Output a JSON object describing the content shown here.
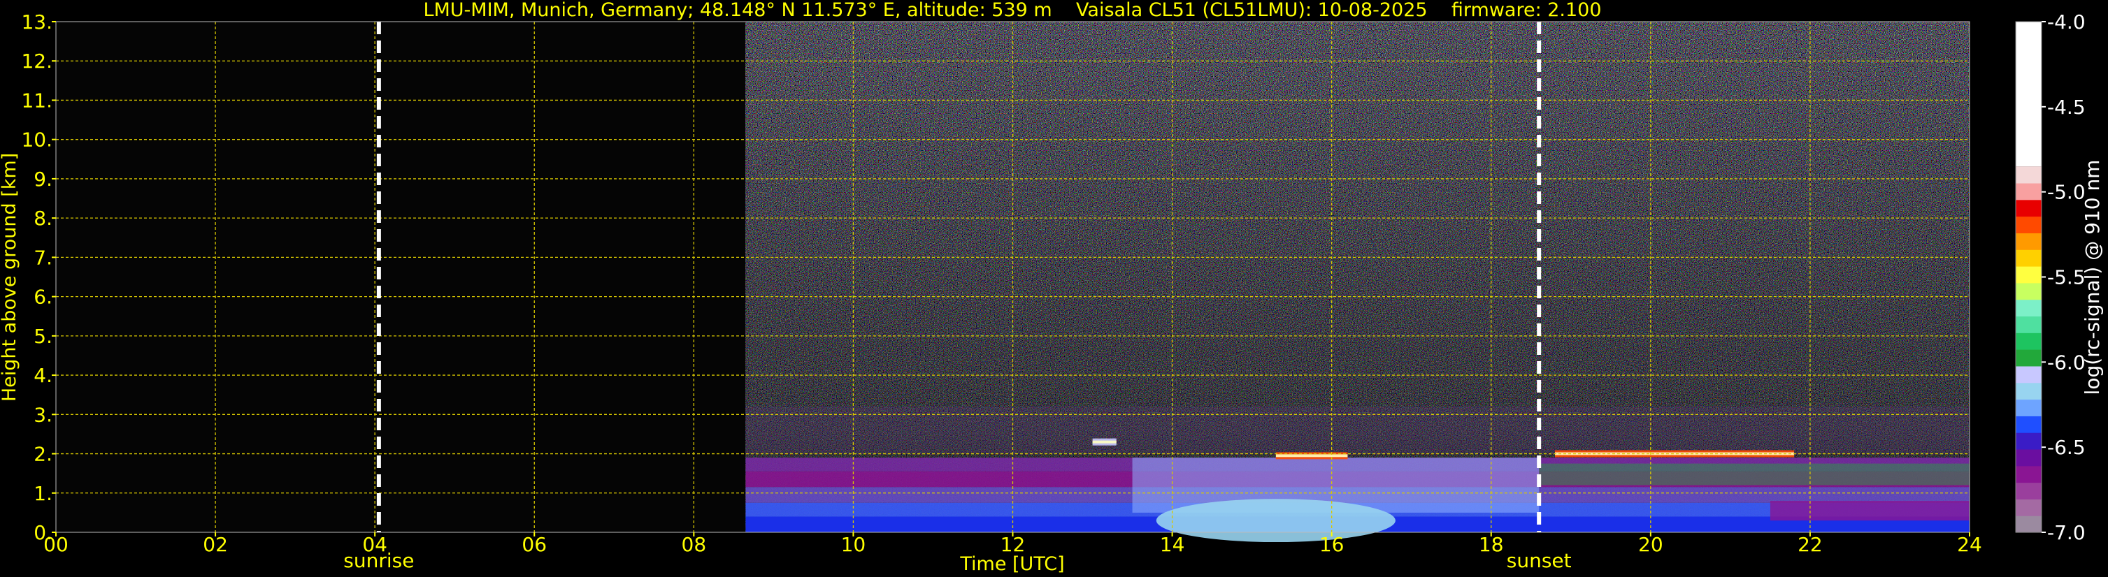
{
  "chart_data": {
    "type": "heatmap",
    "title": "LMU-MIM, Munich, Germany; 48.148° N 11.573° E, altitude: 539 m    Vaisala CL51 (CL51LMU): 10-08-2025    firmware: 2.100",
    "xlabel": "Time [UTC]",
    "ylabel": "Height above ground [km]",
    "xlim": [
      0,
      24
    ],
    "ylim": [
      0,
      13
    ],
    "x_ticks": [
      "00",
      "02",
      "04",
      "06",
      "08",
      "10",
      "12",
      "14",
      "16",
      "18",
      "20",
      "22",
      "24"
    ],
    "y_ticks": [
      "0.",
      "1.",
      "2.",
      "3.",
      "4.",
      "5.",
      "6.",
      "7.",
      "8.",
      "9.",
      "10.",
      "11.",
      "12.",
      "13."
    ],
    "grid": true,
    "data_start_hour": 8.65,
    "data_end_hour": 24,
    "sunrise": {
      "label": "sunrise",
      "hour": 4.05
    },
    "sunset": {
      "label": "sunset",
      "hour": 18.6
    },
    "layers": [
      {
        "kind": "aerosol-boundary-layer",
        "from_hour": 8.65,
        "to_hour": 24,
        "top_km": 1.9,
        "value": -6.4
      },
      {
        "kind": "cloud-band",
        "from_hour": 15.3,
        "to_hour": 16.2,
        "height_km": 1.95,
        "value": -4.5
      },
      {
        "kind": "cloud-band",
        "from_hour": 18.8,
        "to_hour": 21.8,
        "height_km": 2.0,
        "value": -4.5
      },
      {
        "kind": "cloud-band",
        "from_hour": 13.0,
        "to_hour": 13.3,
        "height_km": 2.3,
        "value": -5.8
      },
      {
        "kind": "surface-layer",
        "from_hour": 13.8,
        "to_hour": 16.8,
        "height_km": 0.3,
        "value": -5.9
      }
    ],
    "colorbar": {
      "label": "log(rc-signal) @ 910 nm",
      "range": [
        -7.0,
        -4.0
      ],
      "ticks": [
        "-4.0",
        "-4.5",
        "-5.0",
        "-5.5",
        "-6.0",
        "-6.5",
        "-7.0"
      ],
      "colors": [
        "#9b8aa0",
        "#a46aa3",
        "#9a3f9d",
        "#8a1593",
        "#6a0ea0",
        "#3a1cc6",
        "#1f4fff",
        "#6ea4ff",
        "#98d4f0",
        "#c8c8ff",
        "#22a83a",
        "#1ec460",
        "#4fe0a0",
        "#7cf0c8",
        "#c8ff60",
        "#ffff40",
        "#ffd000",
        "#ff9a00",
        "#ff4a00",
        "#e80000",
        "#f8a0a0",
        "#f4d8d8",
        "#ffffff"
      ]
    }
  }
}
